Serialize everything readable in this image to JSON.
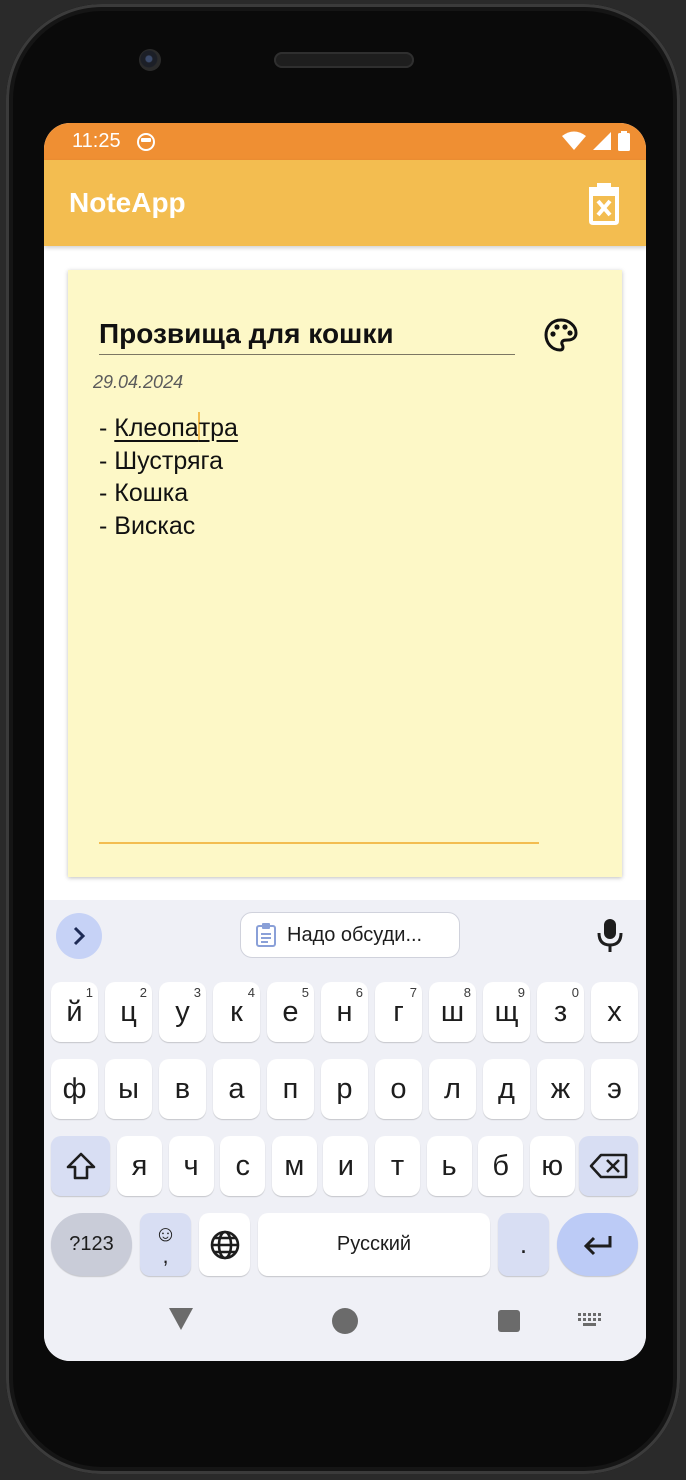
{
  "status_bar": {
    "time": "11:25"
  },
  "app_bar": {
    "title": "NoteApp",
    "delete_icon": "delete-note-icon"
  },
  "note": {
    "title": "Прозвища для кошки",
    "date": "29.04.2024",
    "lines": [
      "- Клеопатра",
      "- Шустряга",
      "- Кошка",
      "- Вискас"
    ],
    "first_line_prefix": "- ",
    "first_line_word_a": "Клеопа",
    "first_line_word_b": "тра",
    "accent_color": "#f3bd50",
    "card_color": "#fdf8c7"
  },
  "keyboard": {
    "clipboard_suggestion": "Надо обсуди...",
    "row1": [
      {
        "k": "й",
        "h": "1"
      },
      {
        "k": "ц",
        "h": "2"
      },
      {
        "k": "у",
        "h": "3"
      },
      {
        "k": "к",
        "h": "4"
      },
      {
        "k": "е",
        "h": "5"
      },
      {
        "k": "н",
        "h": "6"
      },
      {
        "k": "г",
        "h": "7"
      },
      {
        "k": "ш",
        "h": "8"
      },
      {
        "k": "щ",
        "h": "9"
      },
      {
        "k": "з",
        "h": "0"
      },
      {
        "k": "х",
        "h": ""
      }
    ],
    "row2": [
      "ф",
      "ы",
      "в",
      "а",
      "п",
      "р",
      "о",
      "л",
      "д",
      "ж",
      "э"
    ],
    "row3": [
      "я",
      "ч",
      "с",
      "м",
      "и",
      "т",
      "ь",
      "б",
      "ю"
    ],
    "symbols_label": "?123",
    "comma_label": ",",
    "space_label": "Русский",
    "period_label": "."
  }
}
